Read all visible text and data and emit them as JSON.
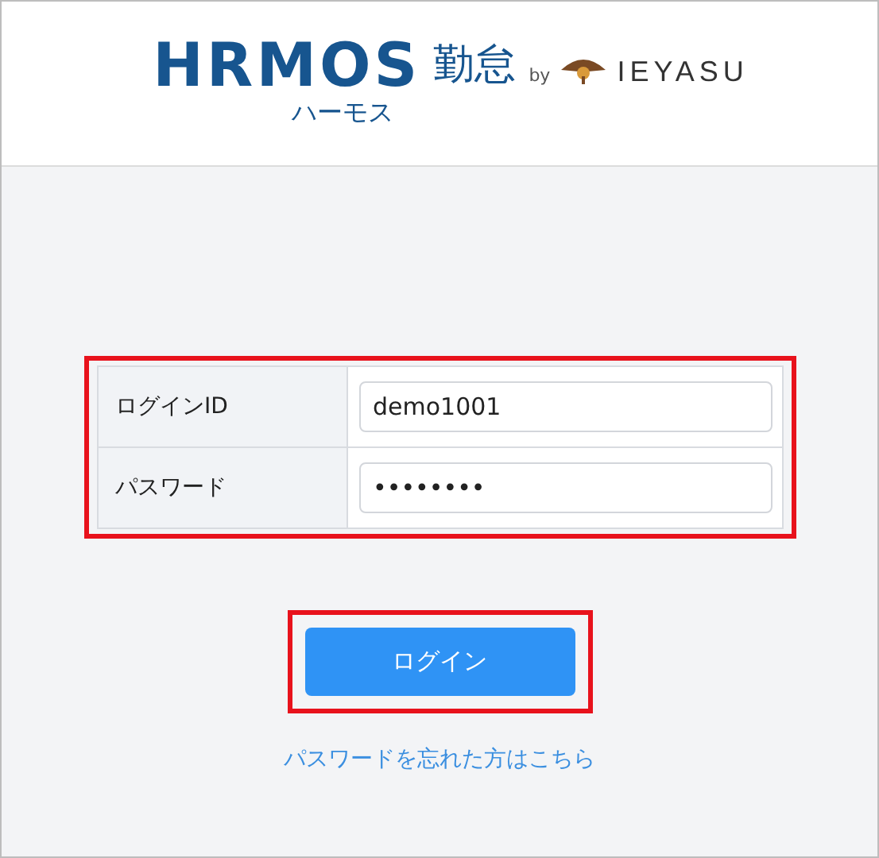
{
  "header": {
    "logo": "HRMOS",
    "logo_suffix": "勤怠",
    "logo_kana": "ハーモス",
    "by": "by",
    "partner": "IEYASU"
  },
  "login_form": {
    "highlighted": true,
    "fields": [
      {
        "label": "ログインID",
        "value": "demo1001"
      },
      {
        "label": "パスワード",
        "value": "••••••••"
      }
    ]
  },
  "login_button": {
    "label": "ログイン",
    "highlighted": true
  },
  "forgot_link": "パスワードを忘れた方はこちら"
}
